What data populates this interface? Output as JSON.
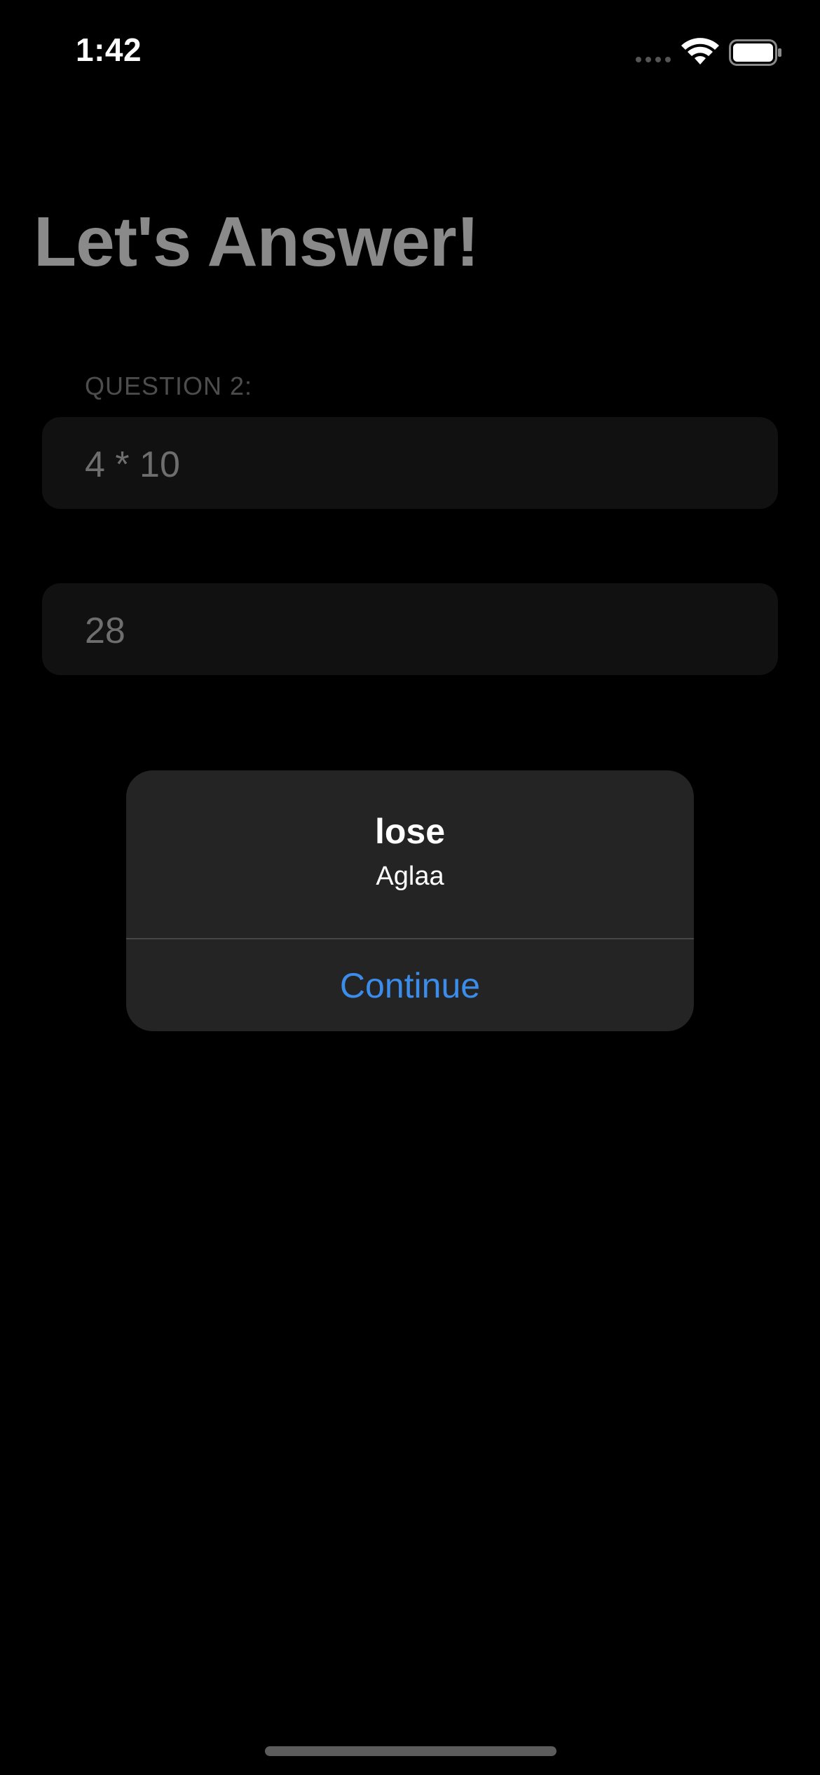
{
  "status_bar": {
    "time": "1:42",
    "signal_icon": "signal-dots-icon",
    "wifi_icon": "wifi-icon",
    "battery_icon": "battery-icon"
  },
  "page": {
    "title": "Let's Answer!",
    "question_header": "QUESTION 2:",
    "question_text": "4 * 10",
    "answer_value": "28"
  },
  "alert": {
    "title": "lose",
    "message": "Aglaa",
    "button_label": "Continue"
  },
  "colors": {
    "background": "#000000",
    "alert_background": "#242424",
    "accent": "#3c8cea",
    "field_background": "#111111"
  }
}
